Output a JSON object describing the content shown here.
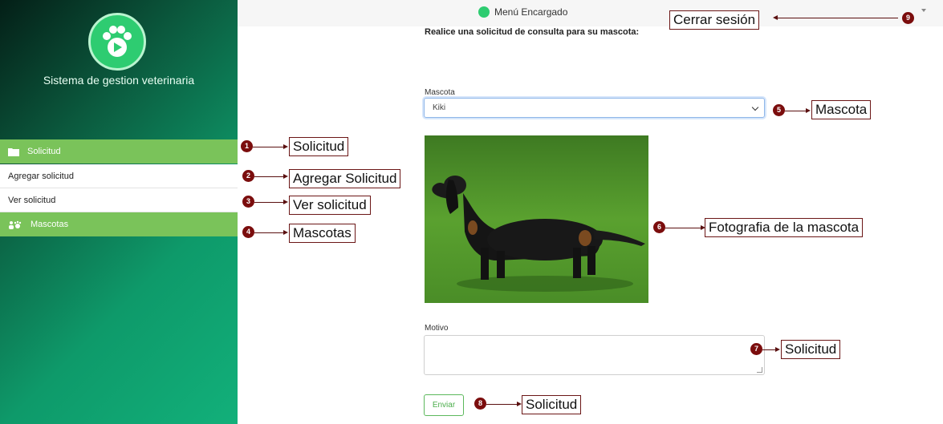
{
  "sidebar": {
    "app_title": "Sistema de gestion veterinaria",
    "items": [
      {
        "label": "Solicitud",
        "icon": "folder-icon"
      },
      {
        "label": "Agregar solicitud"
      },
      {
        "label": "Ver solicitud"
      },
      {
        "label": "Mascotas",
        "icon": "paw-people-icon"
      }
    ]
  },
  "topbar": {
    "title": "Menú Encargado"
  },
  "form": {
    "heading": "Realice una solicitud de consulta para su mascota:",
    "pet_label": "Mascota",
    "pet_value": "Kiki",
    "reason_label": "Motivo",
    "reason_value": "",
    "send_label": "Enviar"
  },
  "annotations": [
    {
      "num": "1",
      "label": "Solicitud"
    },
    {
      "num": "2",
      "label": "Agregar Solicitud"
    },
    {
      "num": "3",
      "label": "Ver solicitud"
    },
    {
      "num": "4",
      "label": "Mascotas"
    },
    {
      "num": "5",
      "label": "Mascota"
    },
    {
      "num": "6",
      "label": "Fotografia de la mascota"
    },
    {
      "num": "7",
      "label": "Solicitud"
    },
    {
      "num": "8",
      "label": "Solicitud"
    },
    {
      "num": "9",
      "label": "Cerrar sesión"
    }
  ],
  "colors": {
    "sidebar_menu_green": "#7ac35a",
    "annotation_badge": "#7b0d0d",
    "send_button": "#5cb85c"
  }
}
